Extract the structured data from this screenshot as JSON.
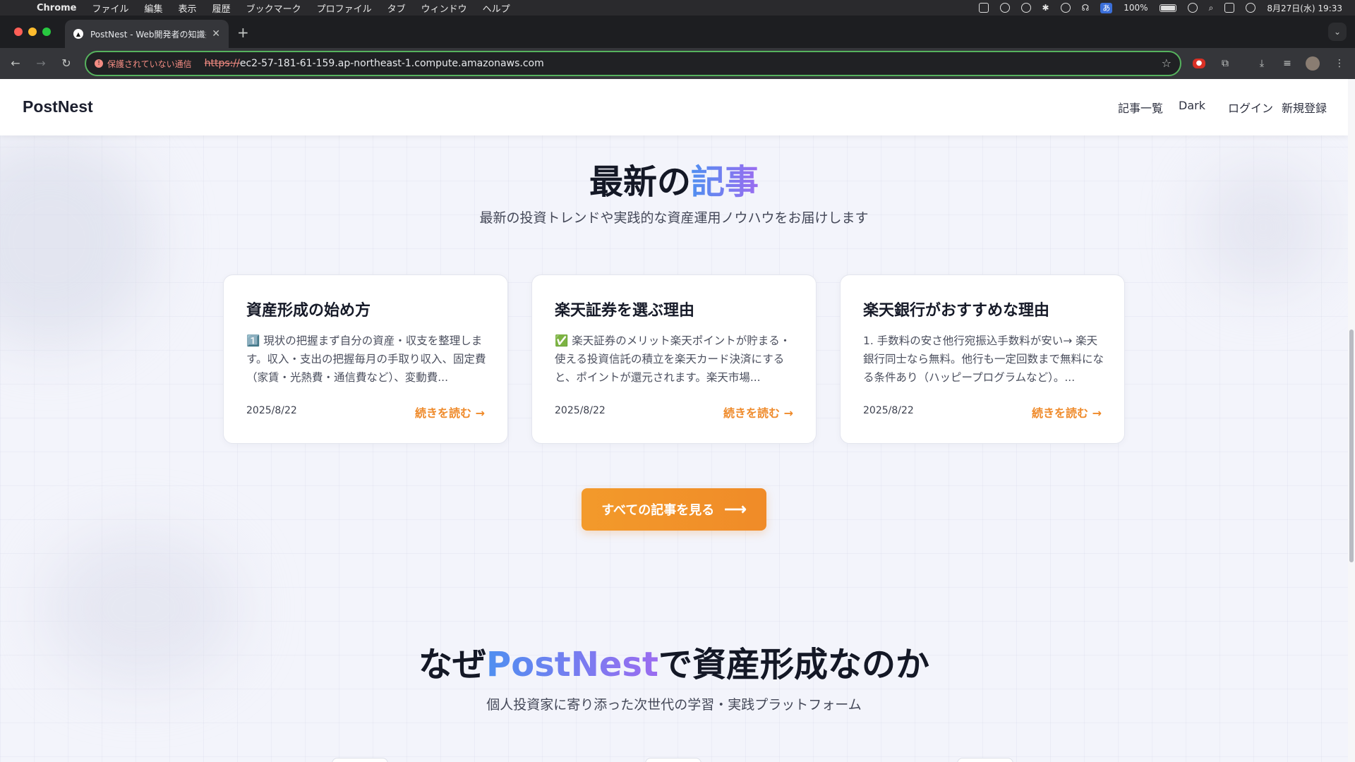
{
  "menubar": {
    "app": "Chrome",
    "items": [
      "ファイル",
      "編集",
      "表示",
      "履歴",
      "ブックマーク",
      "プロファイル",
      "タブ",
      "ウィンドウ",
      "ヘルプ"
    ],
    "status": {
      "ime": "あ",
      "battery": "100%",
      "datetime": "8月27日(水) 19:33"
    }
  },
  "browser": {
    "tab_title": "PostNest - Web開発者の知識共",
    "security_label": "保護されていない通信",
    "url_scheme": "https://",
    "url_host": "ec2-57-181-61-159.ap-northeast-1.compute.amazonaws.com"
  },
  "site": {
    "logo": "PostNest",
    "nav": {
      "articles": "記事一覧",
      "theme": "Dark",
      "login": "ログイン",
      "signup": "新規登録"
    }
  },
  "latest": {
    "title_prefix": "最新の",
    "title_accent": "記事",
    "subtitle": "最新の投資トレンドや実践的な資産運用ノウハウをお届けします",
    "cards": [
      {
        "title": "資産形成の始め方",
        "excerpt": "1️⃣ 現状の把握まず自分の資産・収支を整理します。収入・支出の把握毎月の手取り収入、固定費（家賃・光熱費・通信費など）、変動費...",
        "date": "2025/8/22",
        "more": "続きを読む →"
      },
      {
        "title": "楽天証券を選ぶ理由",
        "excerpt": "✅ 楽天証券のメリット楽天ポイントが貯まる・使える投資信託の積立を楽天カード決済にすると、ポイントが還元されます。楽天市場...",
        "date": "2025/8/22",
        "more": "続きを読む →"
      },
      {
        "title": "楽天銀行がおすすめな理由",
        "excerpt": "1. 手数料の安さ他行宛振込手数料が安い→ 楽天銀行同士なら無料。他行も一定回数まで無料になる条件あり（ハッピープログラムなど）。...",
        "date": "2025/8/22",
        "more": "続きを読む →"
      }
    ],
    "cta": "すべての記事を見る",
    "cta_arrow": "⟶"
  },
  "why": {
    "title_prefix": "なぜ",
    "title_accent": "PostNest",
    "title_suffix": "で資産形成なのか",
    "subtitle": "個人投資家に寄り添った次世代の学習・実践プラットフォーム"
  }
}
